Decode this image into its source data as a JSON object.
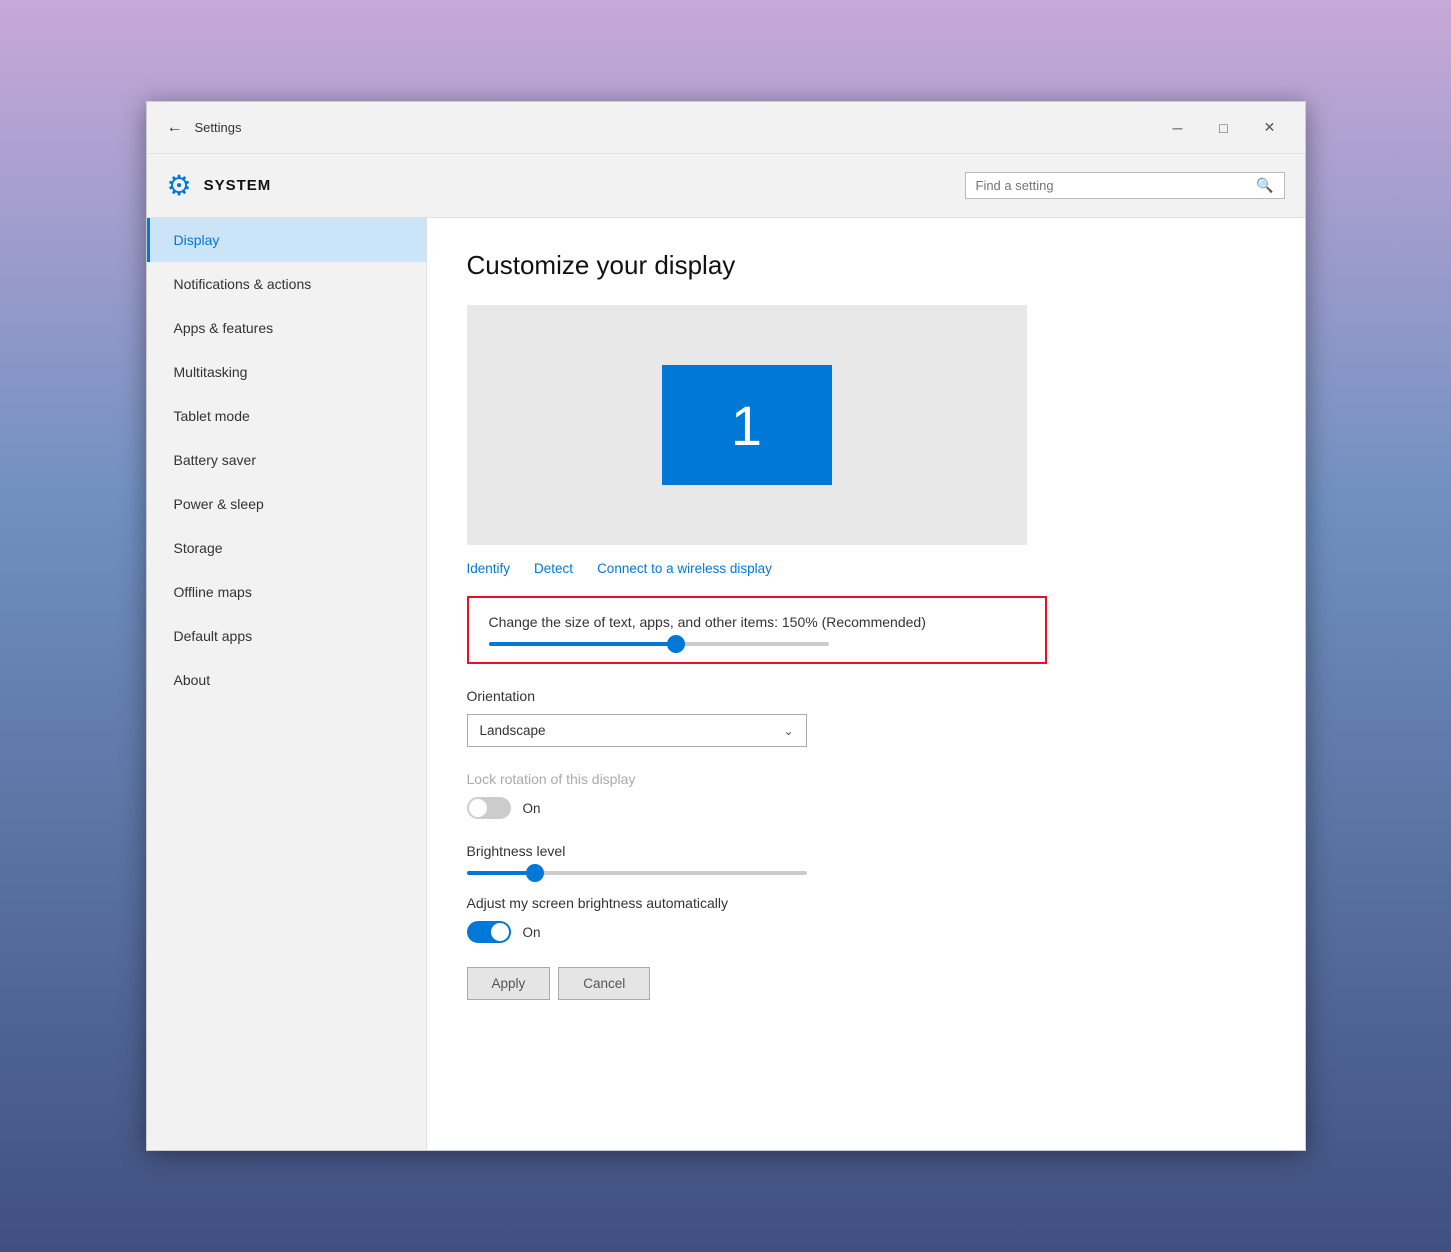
{
  "window": {
    "title": "Settings",
    "minimize_label": "─",
    "maximize_label": "□",
    "close_label": "✕"
  },
  "header": {
    "gear_icon": "⚙",
    "system_label": "SYSTEM",
    "search_placeholder": "Find a setting",
    "search_icon": "🔍"
  },
  "sidebar": {
    "items": [
      {
        "label": "Display",
        "active": true
      },
      {
        "label": "Notifications & actions",
        "active": false
      },
      {
        "label": "Apps & features",
        "active": false
      },
      {
        "label": "Multitasking",
        "active": false
      },
      {
        "label": "Tablet mode",
        "active": false
      },
      {
        "label": "Battery saver",
        "active": false
      },
      {
        "label": "Power & sleep",
        "active": false
      },
      {
        "label": "Storage",
        "active": false
      },
      {
        "label": "Offline maps",
        "active": false
      },
      {
        "label": "Default apps",
        "active": false
      },
      {
        "label": "About",
        "active": false
      }
    ]
  },
  "content": {
    "title": "Customize your display",
    "monitor_number": "1",
    "links": {
      "identify": "Identify",
      "detect": "Detect",
      "connect": "Connect to a wireless display"
    },
    "scale_label": "Change the size of text, apps, and other items: 150% (Recommended)",
    "scale_percent": 55,
    "orientation_label": "Orientation",
    "orientation_value": "Landscape",
    "lock_rotation_label": "Lock rotation of this display",
    "lock_toggle_text": "On",
    "brightness_label": "Brightness level",
    "brightness_percent": 20,
    "auto_brightness_label": "Adjust my screen brightness automatically",
    "auto_toggle_text": "On",
    "apply_label": "Apply",
    "cancel_label": "Cancel"
  }
}
